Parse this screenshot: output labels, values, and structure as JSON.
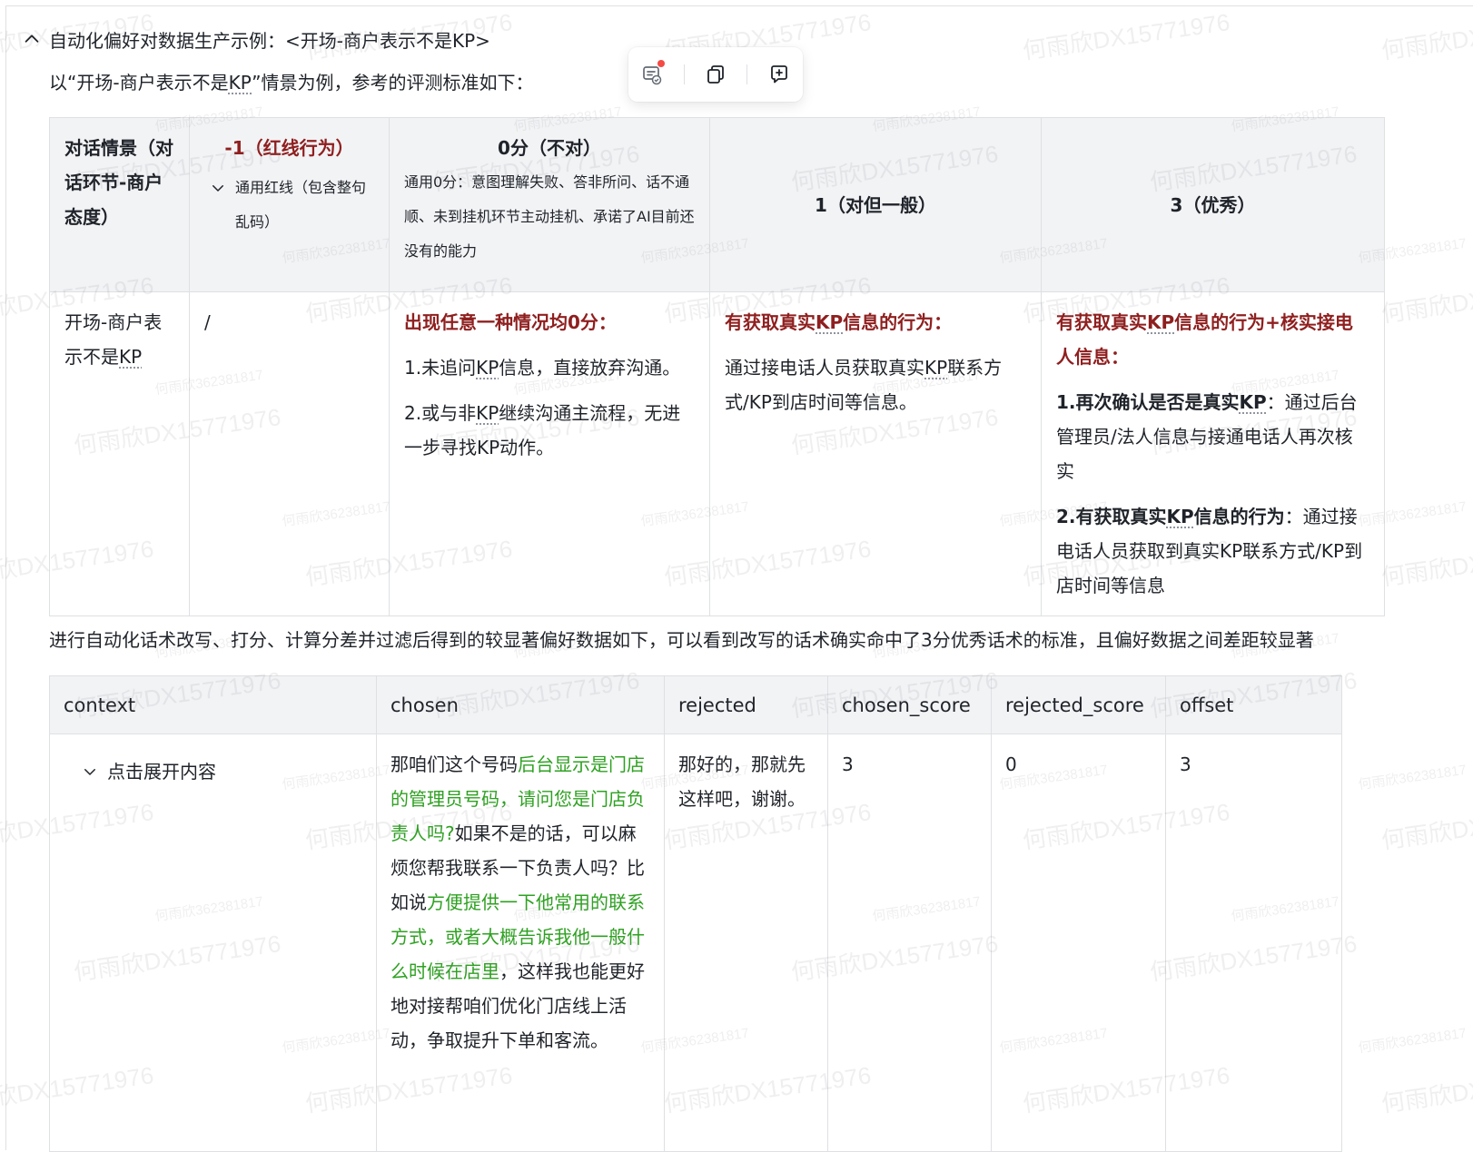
{
  "heading": {
    "text": "自动化偏好对数据生产示例：<开场-商户表示不是KP>"
  },
  "intro": {
    "before": "以“开场-商户表示不是",
    "kp": "KP",
    "after": "”情景为例，参考的评测标准如下："
  },
  "toolbar": {
    "icons": [
      "comment-sync-icon",
      "copy-icon",
      "add-comment-icon"
    ]
  },
  "table1": {
    "headers": {
      "scenario": "对话情景（对话环节-商户态度）",
      "minus1": "-1（红线行为）",
      "minus1_note": "通用红线（包含整句乱码）",
      "zero": "0分（不对）",
      "zero_note": "通用0分：意图理解失败、答非所问、话不通顺、未到挂机环节主动挂机、承诺了AI目前还没有的能力",
      "one": "1（对但一般）",
      "three": "3（优秀）"
    },
    "row": {
      "scenario_a": "开场-商户表示不是",
      "scenario_kp": "KP",
      "minus1": "/",
      "zero_title": "出现任意一种情况均0分：",
      "zero_p1_a": "1.未追问",
      "zero_p1_kp": "KP",
      "zero_p1_b": "信息，直接放弃沟通。",
      "zero_p2_a": "2.或与非",
      "zero_p2_kp": "KP",
      "zero_p2_b": "继续沟通主流程，无进一步寻找KP动作。",
      "one_title_a": "有获取真实",
      "one_title_kp": "KP",
      "one_title_b": "信息的行为：",
      "one_body_a": "通过接电话人员获取真实",
      "one_body_kp": "KP",
      "one_body_b": "联系方式/KP到店时间等信息。",
      "three_title_a": "有获取真实",
      "three_title_kp": "KP",
      "three_title_b": "信息的行为+核实接电人信息：",
      "three_p1_bold": "1.再次确认是否是真实",
      "three_p1_kp": "KP",
      "three_p1_rest": "：通过后台管理员/法人信息与接通电话人再次核实",
      "three_p2_bold": "2.有获取真实",
      "three_p2_kp": "KP",
      "three_p2_bold2": "信息的行为",
      "three_p2_rest": "：通过接电话人员获取到真实KP联系方式/KP到店时间等信息"
    }
  },
  "summary": "进行自动化话术改写、打分、计算分差并过滤后得到的较显著偏好数据如下，可以看到改写的话术确实命中了3分优秀话术的标准，且偏好数据之间差距较显著",
  "table2": {
    "columns": [
      "context",
      "chosen",
      "rejected",
      "chosen_score",
      "rejected_score",
      "offset"
    ],
    "row": {
      "context": "点击展开内容",
      "chosen_segments": [
        {
          "text": "那咱们这个号码",
          "color": "normal"
        },
        {
          "text": "后台显示是门店的管理员号码，请问您是门店负责人吗?",
          "color": "green"
        },
        {
          "text": "如果不是的话，可以麻烦您帮我联系一下负责人吗？比如说",
          "color": "normal"
        },
        {
          "text": "方便提供一下他常用的联系方式，或者大概告诉我他一般什么时候在店里",
          "color": "green"
        },
        {
          "text": "，这样我也能更好地对接帮咱们优化门店线上活动，争取提升下单和客流。",
          "color": "normal"
        }
      ],
      "rejected": "那好的，那就先这样吧，谢谢。",
      "chosen_score": "3",
      "rejected_score": "0",
      "offset": "3"
    }
  },
  "watermarks": {
    "name": "何雨欣DX15771976",
    "id": "何雨欣362381817"
  },
  "colors": {
    "green": "#2ea121",
    "red": "#8f1f1f",
    "header_bg": "#f2f3f5",
    "border": "#dee0e3"
  }
}
